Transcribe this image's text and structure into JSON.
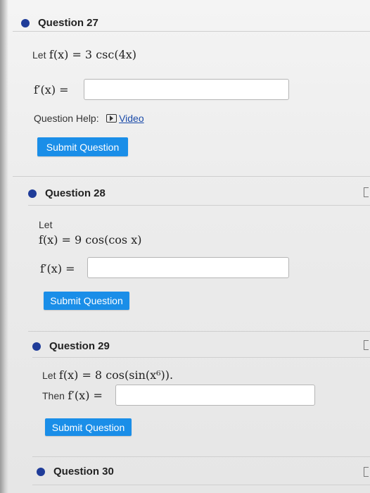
{
  "colors": {
    "accent": "#1a8ee8",
    "bullet": "#1f3c99"
  },
  "questions": [
    {
      "title": "Question 27",
      "lead": "Let",
      "expr": "f(x) = 3 csc(4x)",
      "answer_label": "f′(x) =",
      "help_label": "Question Help:",
      "help_link": "Video",
      "submit": "Submit Question"
    },
    {
      "title": "Question 28",
      "lead": "Let",
      "expr": "f(x) = 9 cos(cos x)",
      "answer_label": "f′(x) =",
      "submit": "Submit Question"
    },
    {
      "title": "Question 29",
      "lead": "Let",
      "expr": "f(x) = 8 cos(sin(x⁶)).",
      "then_label": "Then",
      "answer_label": "f′(x) =",
      "submit": "Submit Question"
    },
    {
      "title": "Question 30"
    }
  ]
}
